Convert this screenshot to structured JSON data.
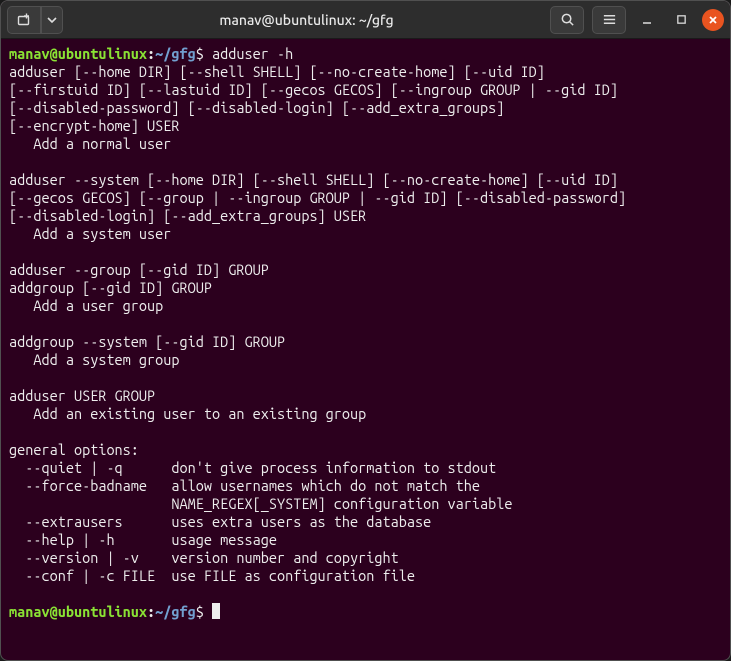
{
  "titlebar": {
    "title": "manav@ubuntulinux: ~/gfg",
    "new_tab_icon": "new-tab",
    "menu_dropdown_icon": "dropdown",
    "search_icon": "search",
    "hamburger_icon": "menu",
    "minimize_icon": "minimize",
    "maximize_icon": "maximize",
    "close_icon": "close"
  },
  "prompt": {
    "user_host": "manav@ubuntulinux",
    "colon": ":",
    "path": "~/gfg",
    "dollar": "$"
  },
  "command1": " adduser -h",
  "output_raw": "adduser [--home DIR] [--shell SHELL] [--no-create-home] [--uid ID]\n[--firstuid ID] [--lastuid ID] [--gecos GECOS] [--ingroup GROUP | --gid ID]\n[--disabled-password] [--disabled-login] [--add_extra_groups]\n[--encrypt-home] USER\n   Add a normal user\n\nadduser --system [--home DIR] [--shell SHELL] [--no-create-home] [--uid ID]\n[--gecos GECOS] [--group | --ingroup GROUP | --gid ID] [--disabled-password]\n[--disabled-login] [--add_extra_groups] USER\n   Add a system user\n\nadduser --group [--gid ID] GROUP\naddgroup [--gid ID] GROUP\n   Add a user group\n\naddgroup --system [--gid ID] GROUP\n   Add a system group\n\nadduser USER GROUP\n   Add an existing user to an existing group\n\ngeneral options:\n  --quiet | -q      don't give process information to stdout\n  --force-badname   allow usernames which do not match the\n                    NAME_REGEX[_SYSTEM] configuration variable\n  --extrausers      uses extra users as the database\n  --help | -h       usage message\n  --version | -v    version number and copyright\n  --conf | -c FILE  use FILE as configuration file\n",
  "command2": " "
}
